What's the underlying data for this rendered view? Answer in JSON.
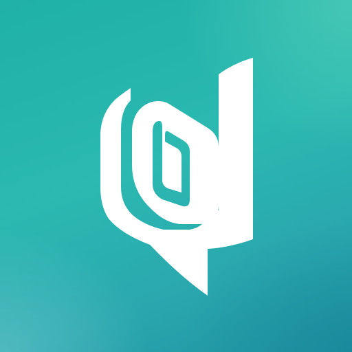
{
  "app_icon": {
    "logo_name": "logo-mark",
    "colors": {
      "logo_fill": "#ffffff",
      "background_top_left": "#1fb0a8",
      "background_top_right": "#5ad2b9",
      "background_bottom_left": "#6ec8cd",
      "background_bottom_right": "#1f93a2"
    }
  }
}
